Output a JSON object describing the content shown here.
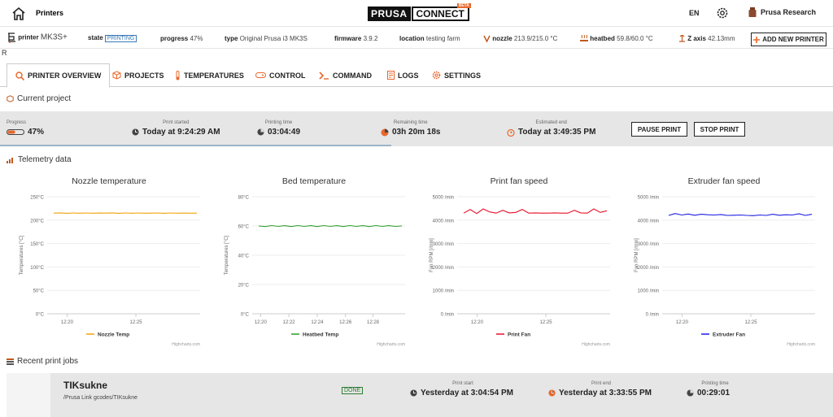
{
  "topbar": {
    "printers_label": "Printers",
    "logo_left": "PRUSA",
    "logo_right": "CONNECT",
    "logo_beta": "BETA",
    "language": "EN",
    "user_name": "Prusa Research"
  },
  "info": {
    "printer_label": "printer",
    "printer_value": "MK3S+",
    "state_label": "state",
    "state_value": "PRINTING",
    "progress_label": "progress",
    "progress_value": "47%",
    "type_label": "type",
    "type_value": "Original Prusa i3 MK3S",
    "firmware_label": "firmware",
    "firmware_value": "3.9.2",
    "location_label": "location",
    "location_value": "testing farm",
    "nozzle_label": "nozzle",
    "nozzle_value": "213.9/215.0 °C",
    "heatbed_label": "heatbed",
    "heatbed_value": "59.8/60.0 °C",
    "zaxis_label": "Z axis",
    "zaxis_value": "42.13mm",
    "add_button": "ADD NEW PRINTER",
    "stray_text": "R"
  },
  "tabs": [
    "PRINTER OVERVIEW",
    "PROJECTS",
    "TEMPERATURES",
    "CONTROL",
    "COMMAND",
    "LOGS",
    "SETTINGS"
  ],
  "current_project": {
    "title": "Current project",
    "progress_label": "Progress",
    "progress_value": "47%",
    "started_label": "Print started",
    "started_value": "Today at 9:24:29 AM",
    "printing_label": "Printing time",
    "printing_value": "03:04:49",
    "remaining_label": "Remaining time",
    "remaining_value": "03h 20m 18s",
    "end_label": "Estimated end",
    "end_value": "Today at 3:49:35 PM",
    "pause_button": "PAUSE PRINT",
    "stop_button": "STOP PRINT"
  },
  "telemetry_title": "Telemetry data",
  "recent": {
    "title": "Recent print jobs",
    "job_name": "TIKsukne",
    "job_path": "/Prusa Link gcodes/TIKsukne",
    "job_state": "DONE",
    "start_label": "Print start",
    "start_value": "Yesterday at 3:04:54 PM",
    "end_label": "Print end",
    "end_value": "Yesterday at 3:33:55 PM",
    "time_label": "Printing time",
    "time_value": "00:29:01"
  },
  "credits": "Highcharts.com",
  "chart_data": [
    {
      "type": "line",
      "title": "Nozzle temperature",
      "ylabel": "Temperatures [°C]",
      "ylim": [
        0,
        250
      ],
      "yticks": [
        "0°C",
        "50°C",
        "100°C",
        "150°C",
        "200°C",
        "250°C"
      ],
      "xticks": [
        "12:20",
        "12:25"
      ],
      "series": [
        {
          "name": "Nozzle Temp",
          "color": "#f0a30a",
          "values": [
            215,
            215.5,
            214.6,
            215.2,
            214.8,
            215.3,
            214.7,
            215.1,
            214.9,
            215.4,
            214.6,
            215.2,
            214.8,
            215.3,
            214.7,
            215.0,
            215.2,
            214.6,
            215.3,
            214.8,
            215.1,
            214.7,
            215.0
          ]
        }
      ]
    },
    {
      "type": "line",
      "title": "Bed temperature",
      "ylabel": "Temperatures [°C]",
      "ylim": [
        0,
        80
      ],
      "yticks": [
        "0°C",
        "20°C",
        "40°C",
        "60°C",
        "80°C"
      ],
      "xticks": [
        "12:20",
        "12:22",
        "12:24",
        "12:26",
        "12:28"
      ],
      "series": [
        {
          "name": "Heatbed Temp",
          "color": "#2e9e2e",
          "values": [
            60,
            59.6,
            60.3,
            59.7,
            60.2,
            59.6,
            60.3,
            59.7,
            60.2,
            59.6,
            60.3,
            59.7,
            60.2,
            59.6,
            60.3,
            59.7,
            60.2,
            59.6,
            60.3,
            59.7,
            60.2,
            59.7,
            60.0
          ]
        }
      ]
    },
    {
      "type": "line",
      "title": "Print fan speed",
      "ylabel": "Fan RPM [/min]",
      "ylim": [
        0,
        5000
      ],
      "yticks": [
        "0 /min",
        "1000 /min",
        "2000 /min",
        "3000 /min",
        "4000 /min",
        "5000 /min"
      ],
      "xticks": [
        "12:20",
        "12:25"
      ],
      "series": [
        {
          "name": "Print Fan",
          "color": "#e8102a",
          "values": [
            4300,
            4450,
            4280,
            4480,
            4350,
            4300,
            4420,
            4310,
            4330,
            4460,
            4300,
            4310,
            4300,
            4300,
            4310,
            4300,
            4300,
            4420,
            4310,
            4300,
            4480,
            4330,
            4400
          ]
        }
      ]
    },
    {
      "type": "line",
      "title": "Extruder fan speed",
      "ylabel": "Fan RPM [/min]",
      "ylim": [
        0,
        5000
      ],
      "yticks": [
        "0 /min",
        "1000 /min",
        "2000 /min",
        "3000 /min",
        "4000 /min",
        "5000 /min"
      ],
      "xticks": [
        "12:20",
        "12:25"
      ],
      "series": [
        {
          "name": "Extruder Fan",
          "color": "#1c1ce0",
          "values": [
            4200,
            4280,
            4220,
            4260,
            4210,
            4250,
            4230,
            4220,
            4240,
            4200,
            4210,
            4220,
            4200,
            4190,
            4220,
            4200,
            4250,
            4210,
            4230,
            4220,
            4270,
            4200,
            4250
          ]
        }
      ]
    }
  ]
}
